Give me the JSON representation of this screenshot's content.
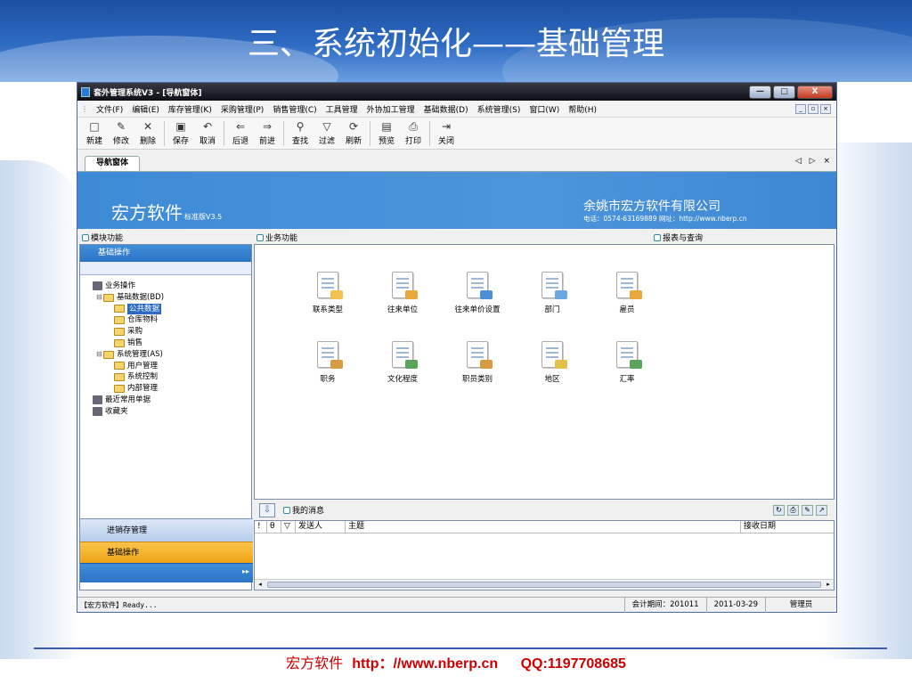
{
  "slide": {
    "title": "三、系统初始化——基础管理",
    "footer_brand": "宏方软件",
    "footer_url": "http：//www.nberp.cn",
    "footer_qq": "QQ:1197708685"
  },
  "window": {
    "title": "套外管理系统V3 - [导航窗体]",
    "controls": [
      "—",
      "□",
      "X"
    ]
  },
  "menu": [
    "文件(F)",
    "编辑(E)",
    "库存管理(K)",
    "采购管理(P)",
    "销售管理(C)",
    "工具管理",
    "外协加工管理",
    "基础数据(D)",
    "系统管理(S)",
    "窗口(W)",
    "帮助(H)"
  ],
  "toolbar": [
    {
      "label": "新建",
      "icon": "□"
    },
    {
      "label": "修改",
      "icon": "✎"
    },
    {
      "label": "删除",
      "icon": "✕"
    },
    {
      "label": "保存",
      "icon": "▣"
    },
    {
      "label": "取消",
      "icon": "↶"
    },
    {
      "label": "后退",
      "icon": "⇐"
    },
    {
      "label": "前进",
      "icon": "⇒"
    },
    {
      "label": "查找",
      "icon": "⚲"
    },
    {
      "label": "过滤",
      "icon": "▽"
    },
    {
      "label": "刷新",
      "icon": "⟳"
    },
    {
      "label": "预览",
      "icon": "▤"
    },
    {
      "label": "打印",
      "icon": "⎙"
    },
    {
      "label": "关闭",
      "icon": "⇥"
    }
  ],
  "tab": {
    "label": "导航窗体",
    "nav": "◁ ▷ ×"
  },
  "banner": {
    "brand": "宏方软件",
    "version": "标准版V3.5",
    "company": "余姚市宏方软件有限公司",
    "contact": "电话：0574-63169889    网址：http://www.nberp.cn"
  },
  "panes": {
    "modules": "模块功能",
    "business": "业务功能",
    "reports": "报表与查询"
  },
  "left": {
    "header": "基础操作",
    "tree": [
      {
        "label": "业务操作",
        "level": 0,
        "kind": "pc",
        "exp": ""
      },
      {
        "label": "基础数据(BD)",
        "level": 1,
        "kind": "folder",
        "exp": "⊟"
      },
      {
        "label": "公共数据",
        "level": 2,
        "kind": "folder",
        "exp": "",
        "selected": true
      },
      {
        "label": "仓库物料",
        "level": 2,
        "kind": "folder",
        "exp": ""
      },
      {
        "label": "采购",
        "level": 2,
        "kind": "folder",
        "exp": ""
      },
      {
        "label": "销售",
        "level": 2,
        "kind": "folder",
        "exp": ""
      },
      {
        "label": "系统管理(AS)",
        "level": 1,
        "kind": "folder",
        "exp": "⊟"
      },
      {
        "label": "用户管理",
        "level": 2,
        "kind": "folder",
        "exp": ""
      },
      {
        "label": "系统控制",
        "level": 2,
        "kind": "folder",
        "exp": ""
      },
      {
        "label": "内部管理",
        "level": 2,
        "kind": "folder",
        "exp": ""
      },
      {
        "label": "最近常用单据",
        "level": 0,
        "kind": "pc",
        "exp": ""
      },
      {
        "label": "收藏夹",
        "level": 0,
        "kind": "pc",
        "exp": ""
      }
    ],
    "bottom_buttons": [
      "进销存管理",
      "基础操作"
    ],
    "expander": "▸▸"
  },
  "functions": [
    {
      "label": "联系类型",
      "color": "#f2c14e"
    },
    {
      "label": "往来单位",
      "color": "#e9a93a"
    },
    {
      "label": "往来单价设置",
      "color": "#4c8fd6"
    },
    {
      "label": "部门",
      "color": "#6aa6e0"
    },
    {
      "label": "雇员",
      "color": "#e9a93a"
    },
    {
      "label": "职务",
      "color": "#d99b3f"
    },
    {
      "label": "文化程度",
      "color": "#5aa35a"
    },
    {
      "label": "职员类别",
      "color": "#d99b3f"
    },
    {
      "label": "地区",
      "color": "#e2c14a"
    },
    {
      "label": "汇率",
      "color": "#5aa35a"
    }
  ],
  "messages": {
    "title": "我的消息",
    "columns": [
      "!",
      "θ",
      "▽",
      "发送人",
      "主题",
      "接收日期"
    ]
  },
  "status": {
    "left": "【宏方软件】Ready...",
    "period": "会计期间：201011",
    "date": "2011-03-29",
    "user": "管理员"
  }
}
